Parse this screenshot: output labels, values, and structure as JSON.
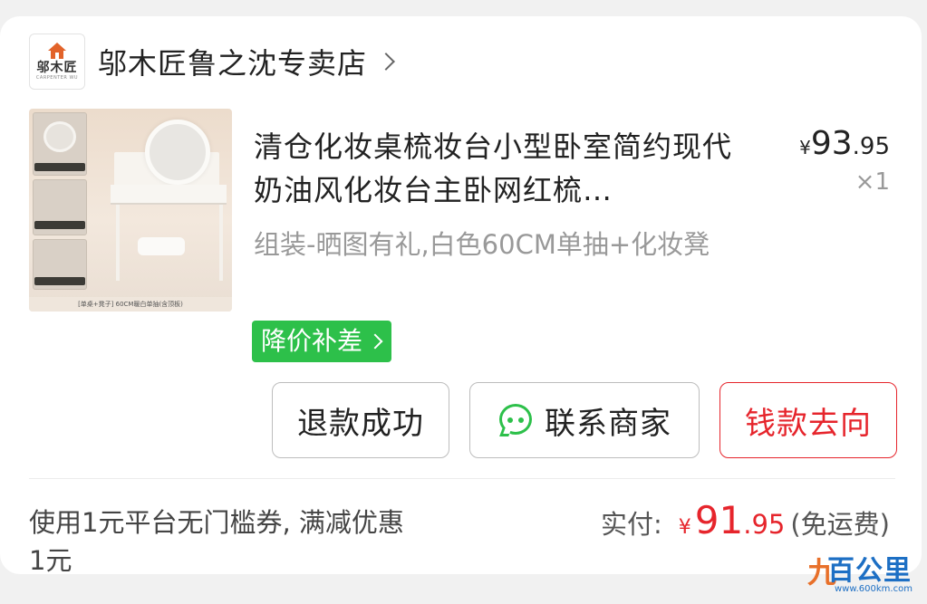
{
  "store": {
    "logo_text": "邬木匠",
    "logo_sub": "CARPENTER WU",
    "name": "邬木匠鲁之沈专卖店"
  },
  "product": {
    "image_caption": "[单桌+凳子] 60CM暖白单抽(含顶板)",
    "title": "清仓化妆桌梳妆台小型卧室简约现代奶油风化妆台主卧网红梳…",
    "sku": "组装-晒图有礼,白色60CM单抽+化妆凳",
    "price_symbol": "¥",
    "price_int": "93",
    "price_dec": ".95",
    "quantity": "×1",
    "promo": "降价补差"
  },
  "actions": {
    "refund_label": "退款成功",
    "contact_label": "联系商家",
    "money_label": "钱款去向"
  },
  "summary": {
    "coupon_text": "使用1元平台无门槛券, 满减优惠1元",
    "paid_label": "实付:",
    "paid_symbol": "¥",
    "paid_int": "91",
    "paid_dec": ".95",
    "shipping": "(免运费)"
  },
  "watermark": {
    "nine": "九",
    "main": "百公里",
    "url": "www.600km.com"
  },
  "colors": {
    "accent_red": "#e6252c",
    "promo_green": "#2dc04a",
    "wechat_green": "#2dc04a",
    "logo_orange": "#e2632a"
  },
  "icons": {
    "store_chevron": "chevron-right-icon",
    "chat": "chat-bubble-icon"
  }
}
